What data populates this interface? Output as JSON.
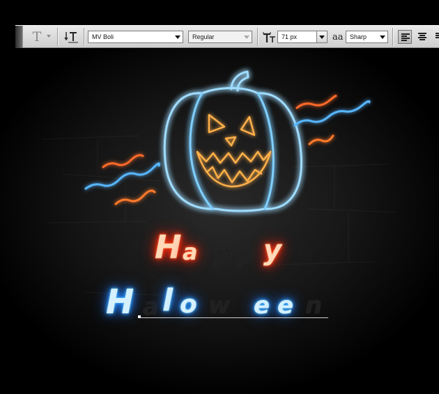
{
  "toolbar": {
    "tool_icon": "T",
    "font_family": "MV Boli",
    "font_style": "Regular",
    "font_size": "71 px",
    "antialias_label": "aa",
    "antialias": "Sharp"
  },
  "canvas": {
    "line1": [
      "H",
      "a",
      "p",
      "p",
      "y"
    ],
    "line2": [
      "H",
      "a",
      "l",
      "o",
      "w",
      "e",
      "e",
      "n"
    ]
  },
  "colors": {
    "neon_blue": "#3aa8ff",
    "neon_orange": "#ff8a2a",
    "neon_red": "#ff2a10"
  }
}
